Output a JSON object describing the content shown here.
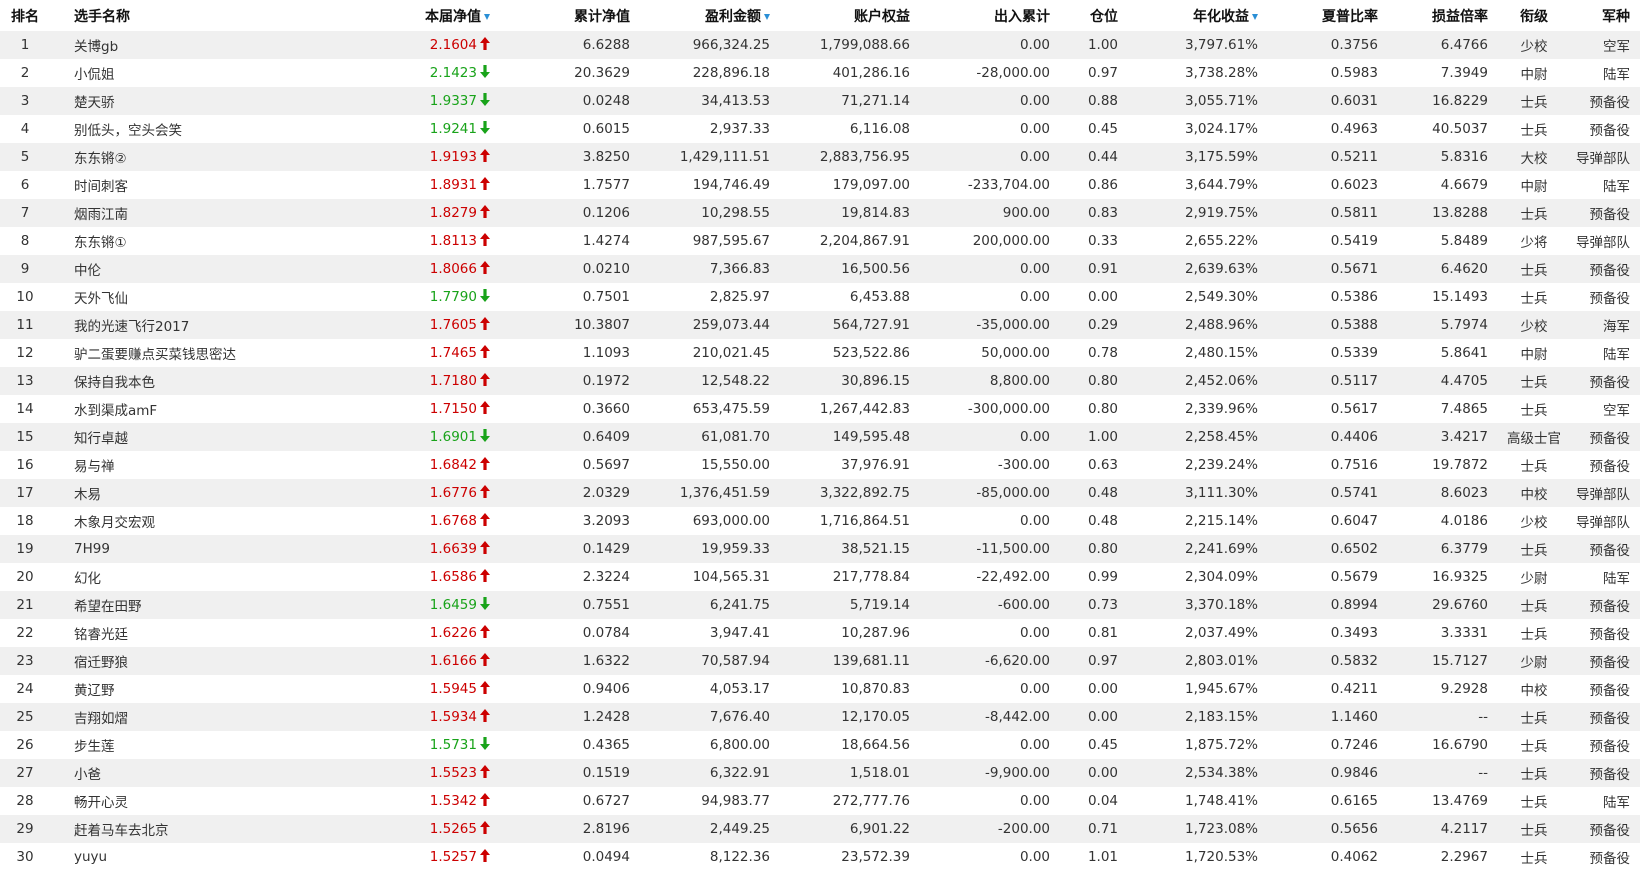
{
  "headers": [
    {
      "key": "rank",
      "label": "排名",
      "sortable": false
    },
    {
      "key": "name",
      "label": "选手名称",
      "sortable": false
    },
    {
      "key": "nav",
      "label": "本届净值",
      "sortable": true
    },
    {
      "key": "cum_nav",
      "label": "累计净值",
      "sortable": false
    },
    {
      "key": "profit",
      "label": "盈利金额",
      "sortable": true
    },
    {
      "key": "equity",
      "label": "账户权益",
      "sortable": false
    },
    {
      "key": "flow",
      "label": "出入累计",
      "sortable": false
    },
    {
      "key": "position",
      "label": "仓位",
      "sortable": false
    },
    {
      "key": "annual",
      "label": "年化收益",
      "sortable": true
    },
    {
      "key": "sharpe",
      "label": "夏普比率",
      "sortable": false
    },
    {
      "key": "pl_ratio",
      "label": "损益倍率",
      "sortable": false
    },
    {
      "key": "grade",
      "label": "衔级",
      "sortable": false
    },
    {
      "key": "branch",
      "label": "军种",
      "sortable": false
    }
  ],
  "colors": {
    "up": "#cc0000",
    "down": "#19a31a",
    "sort_icon": "#2a8fd6",
    "stripe": "#f0f0f0"
  },
  "icons": {
    "up": "arrow-up-icon",
    "down": "arrow-down-icon",
    "sort": "sort-desc-icon"
  },
  "rows": [
    [
      "1",
      "关博gb",
      "2.1604",
      "up",
      "6.6288",
      "966,324.25",
      "1,799,088.66",
      "0.00",
      "1.00",
      "3,797.61%",
      "0.3756",
      "6.4766",
      "少校",
      "空军"
    ],
    [
      "2",
      "小侃姐",
      "2.1423",
      "down",
      "20.3629",
      "228,896.18",
      "401,286.16",
      "-28,000.00",
      "0.97",
      "3,738.28%",
      "0.5983",
      "7.3949",
      "中尉",
      "陆军"
    ],
    [
      "3",
      "楚天骄",
      "1.9337",
      "down",
      "0.0248",
      "34,413.53",
      "71,271.14",
      "0.00",
      "0.88",
      "3,055.71%",
      "0.6031",
      "16.8229",
      "士兵",
      "预备役"
    ],
    [
      "4",
      "别低头，空头会笑",
      "1.9241",
      "down",
      "0.6015",
      "2,937.33",
      "6,116.08",
      "0.00",
      "0.45",
      "3,024.17%",
      "0.4963",
      "40.5037",
      "士兵",
      "预备役"
    ],
    [
      "5",
      "东东锵②",
      "1.9193",
      "up",
      "3.8250",
      "1,429,111.51",
      "2,883,756.95",
      "0.00",
      "0.44",
      "3,175.59%",
      "0.5211",
      "5.8316",
      "大校",
      "导弹部队"
    ],
    [
      "6",
      "时间刺客",
      "1.8931",
      "up",
      "1.7577",
      "194,746.49",
      "179,097.00",
      "-233,704.00",
      "0.86",
      "3,644.79%",
      "0.6023",
      "4.6679",
      "中尉",
      "陆军"
    ],
    [
      "7",
      "烟雨江南",
      "1.8279",
      "up",
      "0.1206",
      "10,298.55",
      "19,814.83",
      "900.00",
      "0.83",
      "2,919.75%",
      "0.5811",
      "13.8288",
      "士兵",
      "预备役"
    ],
    [
      "8",
      "东东锵①",
      "1.8113",
      "up",
      "1.4274",
      "987,595.67",
      "2,204,867.91",
      "200,000.00",
      "0.33",
      "2,655.22%",
      "0.5419",
      "5.8489",
      "少将",
      "导弹部队"
    ],
    [
      "9",
      "中伦",
      "1.8066",
      "up",
      "0.0210",
      "7,366.83",
      "16,500.56",
      "0.00",
      "0.91",
      "2,639.63%",
      "0.5671",
      "6.4620",
      "士兵",
      "预备役"
    ],
    [
      "10",
      "天外飞仙",
      "1.7790",
      "down",
      "0.7501",
      "2,825.97",
      "6,453.88",
      "0.00",
      "0.00",
      "2,549.30%",
      "0.5386",
      "15.1493",
      "士兵",
      "预备役"
    ],
    [
      "11",
      "我的光速飞行2017",
      "1.7605",
      "up",
      "10.3807",
      "259,073.44",
      "564,727.91",
      "-35,000.00",
      "0.29",
      "2,488.96%",
      "0.5388",
      "5.7974",
      "少校",
      "海军"
    ],
    [
      "12",
      "驴二蛋要赚点买菜钱思密达",
      "1.7465",
      "up",
      "1.1093",
      "210,021.45",
      "523,522.86",
      "50,000.00",
      "0.78",
      "2,480.15%",
      "0.5339",
      "5.8641",
      "中尉",
      "陆军"
    ],
    [
      "13",
      "保持自我本色",
      "1.7180",
      "up",
      "0.1972",
      "12,548.22",
      "30,896.15",
      "8,800.00",
      "0.80",
      "2,452.06%",
      "0.5117",
      "4.4705",
      "士兵",
      "预备役"
    ],
    [
      "14",
      "水到渠成amF",
      "1.7150",
      "up",
      "0.3660",
      "653,475.59",
      "1,267,442.83",
      "-300,000.00",
      "0.80",
      "2,339.96%",
      "0.5617",
      "7.4865",
      "士兵",
      "空军"
    ],
    [
      "15",
      "知行卓越",
      "1.6901",
      "down",
      "0.6409",
      "61,081.70",
      "149,595.48",
      "0.00",
      "1.00",
      "2,258.45%",
      "0.4406",
      "3.4217",
      "高级士官",
      "预备役"
    ],
    [
      "16",
      "易与禅",
      "1.6842",
      "up",
      "0.5697",
      "15,550.00",
      "37,976.91",
      "-300.00",
      "0.63",
      "2,239.24%",
      "0.7516",
      "19.7872",
      "士兵",
      "预备役"
    ],
    [
      "17",
      "木易",
      "1.6776",
      "up",
      "2.0329",
      "1,376,451.59",
      "3,322,892.75",
      "-85,000.00",
      "0.48",
      "3,111.30%",
      "0.5741",
      "8.6023",
      "中校",
      "导弹部队"
    ],
    [
      "18",
      "木象月交宏观",
      "1.6768",
      "up",
      "3.2093",
      "693,000.00",
      "1,716,864.51",
      "0.00",
      "0.48",
      "2,215.14%",
      "0.6047",
      "4.0186",
      "少校",
      "导弹部队"
    ],
    [
      "19",
      "7H99",
      "1.6639",
      "up",
      "0.1429",
      "19,959.33",
      "38,521.15",
      "-11,500.00",
      "0.80",
      "2,241.69%",
      "0.6502",
      "6.3779",
      "士兵",
      "预备役"
    ],
    [
      "20",
      "幻化",
      "1.6586",
      "up",
      "2.3224",
      "104,565.31",
      "217,778.84",
      "-22,492.00",
      "0.99",
      "2,304.09%",
      "0.5679",
      "16.9325",
      "少尉",
      "陆军"
    ],
    [
      "21",
      "希望在田野",
      "1.6459",
      "down",
      "0.7551",
      "6,241.75",
      "5,719.14",
      "-600.00",
      "0.73",
      "3,370.18%",
      "0.8994",
      "29.6760",
      "士兵",
      "预备役"
    ],
    [
      "22",
      "铭睿光廷",
      "1.6226",
      "up",
      "0.0784",
      "3,947.41",
      "10,287.96",
      "0.00",
      "0.81",
      "2,037.49%",
      "0.3493",
      "3.3331",
      "士兵",
      "预备役"
    ],
    [
      "23",
      "宿迁野狼",
      "1.6166",
      "up",
      "1.6322",
      "70,587.94",
      "139,681.11",
      "-6,620.00",
      "0.97",
      "2,803.01%",
      "0.5832",
      "15.7127",
      "少尉",
      "预备役"
    ],
    [
      "24",
      "黄辽野",
      "1.5945",
      "up",
      "0.9406",
      "4,053.17",
      "10,870.83",
      "0.00",
      "0.00",
      "1,945.67%",
      "0.4211",
      "9.2928",
      "中校",
      "预备役"
    ],
    [
      "25",
      "吉翔如熠",
      "1.5934",
      "up",
      "1.2428",
      "7,676.40",
      "12,170.05",
      "-8,442.00",
      "0.00",
      "2,183.15%",
      "1.1460",
      "--",
      "士兵",
      "预备役"
    ],
    [
      "26",
      "步生莲",
      "1.5731",
      "down",
      "0.4365",
      "6,800.00",
      "18,664.56",
      "0.00",
      "0.45",
      "1,875.72%",
      "0.7246",
      "16.6790",
      "士兵",
      "预备役"
    ],
    [
      "27",
      "小爸",
      "1.5523",
      "up",
      "0.1519",
      "6,322.91",
      "1,518.01",
      "-9,900.00",
      "0.00",
      "2,534.38%",
      "0.9846",
      "--",
      "士兵",
      "预备役"
    ],
    [
      "28",
      "畅开心灵",
      "1.5342",
      "up",
      "0.6727",
      "94,983.77",
      "272,777.76",
      "0.00",
      "0.04",
      "1,748.41%",
      "0.6165",
      "13.4769",
      "士兵",
      "陆军"
    ],
    [
      "29",
      "赶着马车去北京",
      "1.5265",
      "up",
      "2.8196",
      "2,449.25",
      "6,901.22",
      "-200.00",
      "0.71",
      "1,723.08%",
      "0.5656",
      "4.2117",
      "士兵",
      "预备役"
    ],
    [
      "30",
      "yuyu",
      "1.5257",
      "up",
      "0.0494",
      "8,122.36",
      "23,572.39",
      "0.00",
      "1.01",
      "1,720.53%",
      "0.4062",
      "2.2967",
      "士兵",
      "预备役"
    ]
  ]
}
